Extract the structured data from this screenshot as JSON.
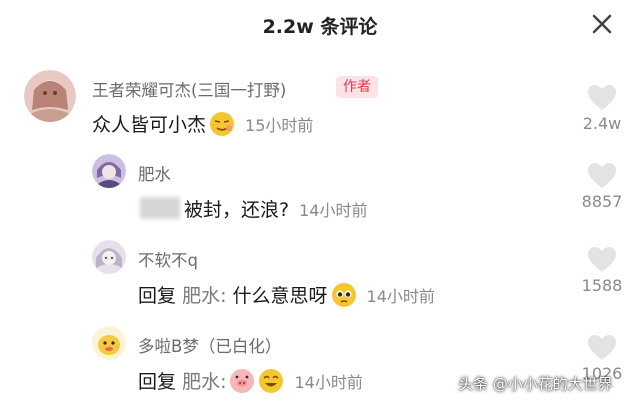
{
  "header": {
    "title": "2.2w 条评论"
  },
  "comments": [
    {
      "username": "王者荣耀可杰(三国一打野)",
      "badge": "作者",
      "text": "众人皆可小杰",
      "time": "15小时前",
      "likes": "2.4w",
      "icons": [
        "avatar-illustration",
        "smirk-emoji",
        "heart-icon"
      ]
    },
    {
      "username": "肥水",
      "text": "被封，还浪?",
      "time": "14小时前",
      "likes": "8857",
      "icons": [
        "avatar-anime",
        "heart-icon"
      ]
    },
    {
      "username": "不软不q",
      "reply_label": "回复",
      "reply_target": "肥水:",
      "text": "什么意思呀",
      "time": "14小时前",
      "likes": "1588",
      "icons": [
        "avatar-anime",
        "pleading-emoji",
        "heart-icon"
      ]
    },
    {
      "username": "多啦B梦（已白化）",
      "reply_label": "回复",
      "reply_target": "肥水:",
      "time": "14小时前",
      "likes": "1026",
      "icons": [
        "avatar-cartoon",
        "pig-emoji",
        "grin-emoji",
        "heart-icon"
      ]
    }
  ],
  "watermark": "头条 @小小花的大世界",
  "colors": {
    "badge_bg": "#fde3e8",
    "badge_text": "#e8374f",
    "heart": "#e3e3e3",
    "muted_text": "#8a8a8a"
  }
}
